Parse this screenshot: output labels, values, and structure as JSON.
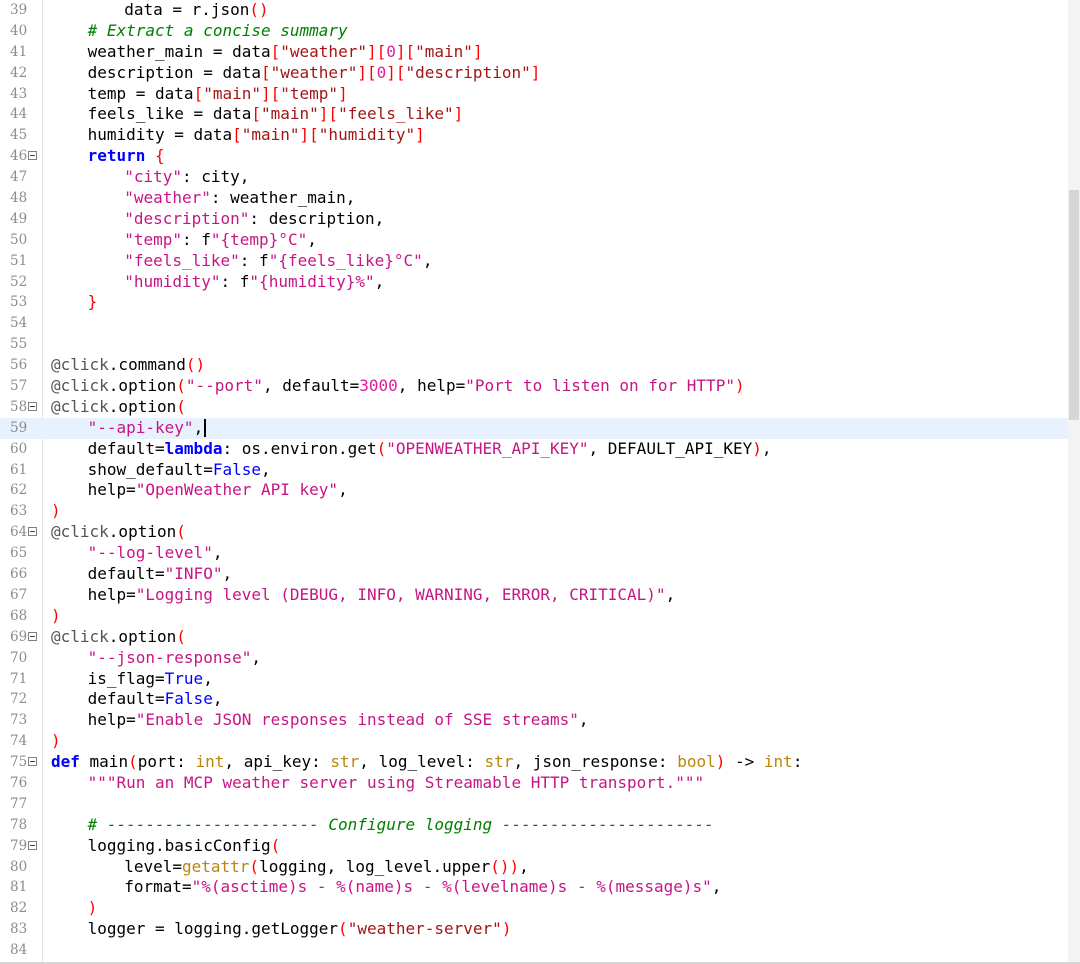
{
  "editor": {
    "lines": [
      {
        "n": "39",
        "fold": false,
        "indent": 2,
        "tokens": [
          [
            "",
            "data = r.json"
          ],
          [
            "paren",
            "()"
          ]
        ]
      },
      {
        "n": "40",
        "fold": false,
        "indent": 1,
        "tokens": [
          [
            "cm",
            "# Extract a concise summary"
          ]
        ]
      },
      {
        "n": "41",
        "fold": false,
        "indent": 1,
        "tokens": [
          [
            "",
            "weather_main = data"
          ],
          [
            "paren",
            "["
          ],
          [
            "str",
            "\"weather\""
          ],
          [
            "paren",
            "]["
          ],
          [
            "num",
            "0"
          ],
          [
            "paren",
            "]["
          ],
          [
            "str",
            "\"main\""
          ],
          [
            "paren",
            "]"
          ]
        ]
      },
      {
        "n": "42",
        "fold": false,
        "indent": 1,
        "tokens": [
          [
            "",
            "description = data"
          ],
          [
            "paren",
            "["
          ],
          [
            "str",
            "\"weather\""
          ],
          [
            "paren",
            "]["
          ],
          [
            "num",
            "0"
          ],
          [
            "paren",
            "]["
          ],
          [
            "str",
            "\"description\""
          ],
          [
            "paren",
            "]"
          ]
        ]
      },
      {
        "n": "43",
        "fold": false,
        "indent": 1,
        "tokens": [
          [
            "",
            "temp = data"
          ],
          [
            "paren",
            "["
          ],
          [
            "str",
            "\"main\""
          ],
          [
            "paren",
            "]["
          ],
          [
            "str",
            "\"temp\""
          ],
          [
            "paren",
            "]"
          ]
        ]
      },
      {
        "n": "44",
        "fold": false,
        "indent": 1,
        "tokens": [
          [
            "",
            "feels_like = data"
          ],
          [
            "paren",
            "["
          ],
          [
            "str",
            "\"main\""
          ],
          [
            "paren",
            "]["
          ],
          [
            "str",
            "\"feels_like\""
          ],
          [
            "paren",
            "]"
          ]
        ]
      },
      {
        "n": "45",
        "fold": false,
        "indent": 1,
        "tokens": [
          [
            "",
            "humidity = data"
          ],
          [
            "paren",
            "["
          ],
          [
            "str",
            "\"main\""
          ],
          [
            "paren",
            "]["
          ],
          [
            "str",
            "\"humidity\""
          ],
          [
            "paren",
            "]"
          ]
        ]
      },
      {
        "n": "46",
        "fold": true,
        "indent": 1,
        "tokens": [
          [
            "kw",
            "return"
          ],
          [
            "",
            " "
          ],
          [
            "paren",
            "{"
          ]
        ]
      },
      {
        "n": "47",
        "fold": false,
        "indent": 2,
        "tokens": [
          [
            "str2",
            "\"city\""
          ],
          [
            "",
            ": city,"
          ]
        ]
      },
      {
        "n": "48",
        "fold": false,
        "indent": 2,
        "tokens": [
          [
            "str2",
            "\"weather\""
          ],
          [
            "",
            ": weather_main,"
          ]
        ]
      },
      {
        "n": "49",
        "fold": false,
        "indent": 2,
        "tokens": [
          [
            "str2",
            "\"description\""
          ],
          [
            "",
            ": description,"
          ]
        ]
      },
      {
        "n": "50",
        "fold": false,
        "indent": 2,
        "tokens": [
          [
            "str2",
            "\"temp\""
          ],
          [
            "",
            ": f"
          ],
          [
            "str2",
            "\"{temp}°C\""
          ],
          [
            "",
            ","
          ]
        ]
      },
      {
        "n": "51",
        "fold": false,
        "indent": 2,
        "tokens": [
          [
            "str2",
            "\"feels_like\""
          ],
          [
            "",
            ": f"
          ],
          [
            "str2",
            "\"{feels_like}°C\""
          ],
          [
            "",
            ","
          ]
        ]
      },
      {
        "n": "52",
        "fold": false,
        "indent": 2,
        "tokens": [
          [
            "str2",
            "\"humidity\""
          ],
          [
            "",
            ": f"
          ],
          [
            "str2",
            "\"{humidity}%\""
          ],
          [
            "",
            ","
          ]
        ]
      },
      {
        "n": "53",
        "fold": false,
        "indent": 1,
        "tokens": [
          [
            "paren",
            "}"
          ]
        ]
      },
      {
        "n": "54",
        "fold": false,
        "indent": 0,
        "tokens": []
      },
      {
        "n": "55",
        "fold": false,
        "indent": 0,
        "tokens": []
      },
      {
        "n": "56",
        "fold": false,
        "indent": 0,
        "tokens": [
          [
            "dec",
            "@click"
          ],
          [
            "",
            ".command"
          ],
          [
            "paren",
            "()"
          ]
        ]
      },
      {
        "n": "57",
        "fold": false,
        "indent": 0,
        "tokens": [
          [
            "dec",
            "@click"
          ],
          [
            "",
            ".option"
          ],
          [
            "paren",
            "("
          ],
          [
            "str2",
            "\"--port\""
          ],
          [
            "",
            ", default="
          ],
          [
            "num",
            "3000"
          ],
          [
            "",
            ", help="
          ],
          [
            "str2",
            "\"Port to listen on for HTTP\""
          ],
          [
            "paren",
            ")"
          ]
        ]
      },
      {
        "n": "58",
        "fold": true,
        "indent": 0,
        "tokens": [
          [
            "dec",
            "@click"
          ],
          [
            "",
            ".option"
          ],
          [
            "paren",
            "("
          ]
        ]
      },
      {
        "n": "59",
        "fold": false,
        "indent": 1,
        "current": true,
        "tokens": [
          [
            "str2",
            "\"--api-key\""
          ],
          [
            "",
            ","
          ]
        ]
      },
      {
        "n": "60",
        "fold": false,
        "indent": 1,
        "tokens": [
          [
            "",
            "default="
          ],
          [
            "kw",
            "lambda"
          ],
          [
            "",
            ": os.environ.get"
          ],
          [
            "paren",
            "("
          ],
          [
            "str2",
            "\"OPENWEATHER_API_KEY\""
          ],
          [
            "",
            ", DEFAULT_API_KEY"
          ],
          [
            "paren",
            ")"
          ],
          [
            "",
            ","
          ]
        ]
      },
      {
        "n": "61",
        "fold": false,
        "indent": 1,
        "tokens": [
          [
            "",
            "show_default="
          ],
          [
            "bi",
            "False"
          ],
          [
            "",
            ","
          ]
        ]
      },
      {
        "n": "62",
        "fold": false,
        "indent": 1,
        "tokens": [
          [
            "",
            "help="
          ],
          [
            "str2",
            "\"OpenWeather API key\""
          ],
          [
            "",
            ","
          ]
        ]
      },
      {
        "n": "63",
        "fold": false,
        "indent": 0,
        "tokens": [
          [
            "paren",
            ")"
          ]
        ]
      },
      {
        "n": "64",
        "fold": true,
        "indent": 0,
        "tokens": [
          [
            "dec",
            "@click"
          ],
          [
            "",
            ".option"
          ],
          [
            "paren",
            "("
          ]
        ]
      },
      {
        "n": "65",
        "fold": false,
        "indent": 1,
        "tokens": [
          [
            "str2",
            "\"--log-level\""
          ],
          [
            "",
            ","
          ]
        ]
      },
      {
        "n": "66",
        "fold": false,
        "indent": 1,
        "tokens": [
          [
            "",
            "default="
          ],
          [
            "str2",
            "\"INFO\""
          ],
          [
            "",
            ","
          ]
        ]
      },
      {
        "n": "67",
        "fold": false,
        "indent": 1,
        "tokens": [
          [
            "",
            "help="
          ],
          [
            "str2",
            "\"Logging level (DEBUG, INFO, WARNING, ERROR, CRITICAL)\""
          ],
          [
            "",
            ","
          ]
        ]
      },
      {
        "n": "68",
        "fold": false,
        "indent": 0,
        "tokens": [
          [
            "paren",
            ")"
          ]
        ]
      },
      {
        "n": "69",
        "fold": true,
        "indent": 0,
        "tokens": [
          [
            "dec",
            "@click"
          ],
          [
            "",
            ".option"
          ],
          [
            "paren",
            "("
          ]
        ]
      },
      {
        "n": "70",
        "fold": false,
        "indent": 1,
        "tokens": [
          [
            "str2",
            "\"--json-response\""
          ],
          [
            "",
            ","
          ]
        ]
      },
      {
        "n": "71",
        "fold": false,
        "indent": 1,
        "tokens": [
          [
            "",
            "is_flag="
          ],
          [
            "bi",
            "True"
          ],
          [
            "",
            ","
          ]
        ]
      },
      {
        "n": "72",
        "fold": false,
        "indent": 1,
        "tokens": [
          [
            "",
            "default="
          ],
          [
            "bi",
            "False"
          ],
          [
            "",
            ","
          ]
        ]
      },
      {
        "n": "73",
        "fold": false,
        "indent": 1,
        "tokens": [
          [
            "",
            "help="
          ],
          [
            "str2",
            "\"Enable JSON responses instead of SSE streams\""
          ],
          [
            "",
            ","
          ]
        ]
      },
      {
        "n": "74",
        "fold": false,
        "indent": 0,
        "tokens": [
          [
            "paren",
            ")"
          ]
        ]
      },
      {
        "n": "75",
        "fold": true,
        "indent": 0,
        "tokens": [
          [
            "kw",
            "def"
          ],
          [
            "",
            " main"
          ],
          [
            "paren",
            "("
          ],
          [
            "",
            "port: "
          ],
          [
            "tp",
            "int"
          ],
          [
            "",
            ", api_key: "
          ],
          [
            "tp",
            "str"
          ],
          [
            "",
            ", log_level: "
          ],
          [
            "tp",
            "str"
          ],
          [
            "",
            ", json_response: "
          ],
          [
            "tp",
            "bool"
          ],
          [
            "paren",
            ")"
          ],
          [
            "",
            " -> "
          ],
          [
            "tp",
            "int"
          ],
          [
            "",
            ":"
          ]
        ]
      },
      {
        "n": "76",
        "fold": false,
        "indent": 1,
        "tokens": [
          [
            "str2",
            "\"\"\"Run an MCP weather server using Streamable HTTP transport.\"\"\""
          ]
        ]
      },
      {
        "n": "77",
        "fold": false,
        "indent": 0,
        "tokens": []
      },
      {
        "n": "78",
        "fold": false,
        "indent": 1,
        "tokens": [
          [
            "cm",
            "# ---------------------- Configure logging ----------------------"
          ]
        ]
      },
      {
        "n": "79",
        "fold": true,
        "indent": 1,
        "tokens": [
          [
            "",
            "logging.basicConfig"
          ],
          [
            "paren",
            "("
          ]
        ]
      },
      {
        "n": "80",
        "fold": false,
        "indent": 2,
        "tokens": [
          [
            "",
            "level="
          ],
          [
            "tp",
            "getattr"
          ],
          [
            "paren",
            "("
          ],
          [
            "",
            "logging, log_level.upper"
          ],
          [
            "paren",
            "())"
          ],
          [
            "",
            ","
          ]
        ]
      },
      {
        "n": "81",
        "fold": false,
        "indent": 2,
        "tokens": [
          [
            "",
            "format="
          ],
          [
            "str2",
            "\"%(asctime)s - %(name)s - %(levelname)s - %(message)s\""
          ],
          [
            "",
            ","
          ]
        ]
      },
      {
        "n": "82",
        "fold": false,
        "indent": 1,
        "tokens": [
          [
            "paren",
            ")"
          ]
        ]
      },
      {
        "n": "83",
        "fold": false,
        "indent": 1,
        "tokens": [
          [
            "",
            "logger = logging.getLogger"
          ],
          [
            "paren",
            "("
          ],
          [
            "str",
            "\"weather-server\""
          ],
          [
            "paren",
            ")"
          ]
        ]
      },
      {
        "n": "84",
        "fold": false,
        "indent": 0,
        "tokens": []
      }
    ]
  }
}
